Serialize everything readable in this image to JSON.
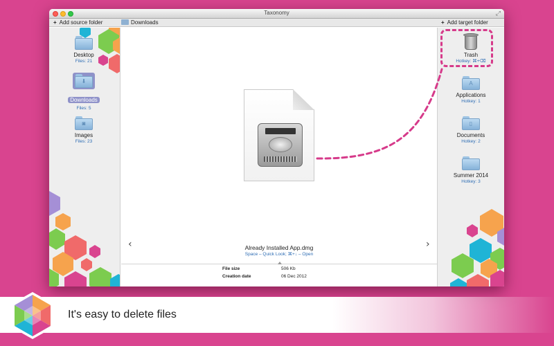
{
  "window": {
    "title": "Taxonomy"
  },
  "toolbar": {
    "add_source_label": "Add source folder",
    "add_target_label": "Add target folder",
    "breadcrumb": "Downloads"
  },
  "source_folders": [
    {
      "name": "Desktop",
      "sub": "Files: 21",
      "selected": false
    },
    {
      "name": "Downloads",
      "sub": "Files: 5",
      "selected": true
    },
    {
      "name": "Images",
      "sub": "Files: 23",
      "selected": false
    }
  ],
  "target_folders": [
    {
      "name": "Trash",
      "sub": "Hotkey: ⌘+⌫",
      "icon": "trash-icon"
    },
    {
      "name": "Applications",
      "sub": "Hotkey: 1",
      "icon": "applications-folder-icon"
    },
    {
      "name": "Documents",
      "sub": "Hotkey: 2",
      "icon": "documents-folder-icon"
    },
    {
      "name": "Summer 2014",
      "sub": "Hotkey: 3",
      "icon": "folder-icon"
    }
  ],
  "preview": {
    "file_name": "Already Installed App.dmg",
    "hint": "Space – Quick Look; ⌘+↓ – Open",
    "prev_glyph": "‹",
    "next_glyph": "›"
  },
  "info": {
    "size_label": "File size",
    "size_value": "506 Kb",
    "date_label": "Creation date",
    "date_value": "06 Dec 2012"
  },
  "banner": {
    "text": "It's easy to delete files"
  },
  "colors": {
    "background": "#d9448f",
    "accent_dash": "#d63a8a",
    "link_blue": "#2e6db4",
    "selection": "#8f92c9"
  }
}
